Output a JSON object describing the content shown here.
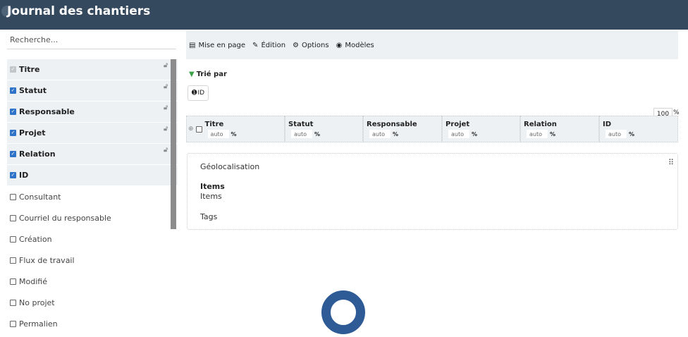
{
  "app": {
    "title": "Journal des chantiers"
  },
  "search": {
    "placeholder": "Recherche..."
  },
  "fields": [
    {
      "label": "Titre",
      "checked": true,
      "disabled": true,
      "locked": true
    },
    {
      "label": "Statut",
      "checked": true,
      "locked": true
    },
    {
      "label": "Responsable",
      "checked": true,
      "locked": true
    },
    {
      "label": "Projet",
      "checked": true,
      "locked": true
    },
    {
      "label": "Relation",
      "checked": true,
      "locked": true
    },
    {
      "label": "ID",
      "checked": true,
      "locked": false
    },
    {
      "label": "Consultant",
      "checked": false
    },
    {
      "label": "Courriel du responsable",
      "checked": false
    },
    {
      "label": "Création",
      "checked": false
    },
    {
      "label": "Flux de travail",
      "checked": false
    },
    {
      "label": "Modifié",
      "checked": false
    },
    {
      "label": "No projet",
      "checked": false
    },
    {
      "label": "Permalien",
      "checked": false
    }
  ],
  "toolbar": {
    "layout_label": "Mise en page",
    "edit_label": "Édition",
    "options_label": "Options",
    "models_label": "Modèles"
  },
  "sort": {
    "label": "Trié par",
    "field": "ID"
  },
  "table_width": {
    "value": "100",
    "unit": "%"
  },
  "columns": [
    {
      "name": "Titre",
      "width": "auto",
      "unit": "%"
    },
    {
      "name": "Statut",
      "width": "auto",
      "unit": "%"
    },
    {
      "name": "Responsable",
      "width": "auto",
      "unit": "%"
    },
    {
      "name": "Projet",
      "width": "auto",
      "unit": "%"
    },
    {
      "name": "Relation",
      "width": "auto",
      "unit": "%"
    },
    {
      "name": "ID",
      "width": "auto",
      "unit": "%"
    }
  ],
  "extras": {
    "geo": "Géolocalisation",
    "items_heading": "Items",
    "items_text": "Items",
    "tags": "Tags"
  },
  "colors": {
    "header_bg": "#34495e",
    "accent": "#2f73c9",
    "panel_bg": "#eef1f4",
    "loader": "#2e5b95"
  }
}
